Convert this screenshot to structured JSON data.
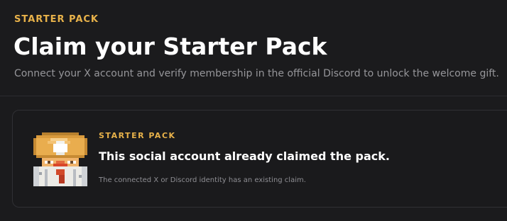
{
  "header": {
    "eyebrow": "STARTER PACK",
    "title": "Claim your Starter Pack",
    "subtitle": "Connect your X account and verify membership in the official Discord to unlock the welcome gift."
  },
  "status_card": {
    "eyebrow": "STARTER PACK",
    "title": "This social account already claimed the pack.",
    "description": "The connected X or Discord identity has an existing claim.",
    "image_icon": "pixel-chef-character-icon"
  },
  "colors": {
    "background": "#1b1b1d",
    "accent": "#e8b24a",
    "title": "#ffffff",
    "muted_text": "#96969a",
    "card_border": "#303034"
  }
}
